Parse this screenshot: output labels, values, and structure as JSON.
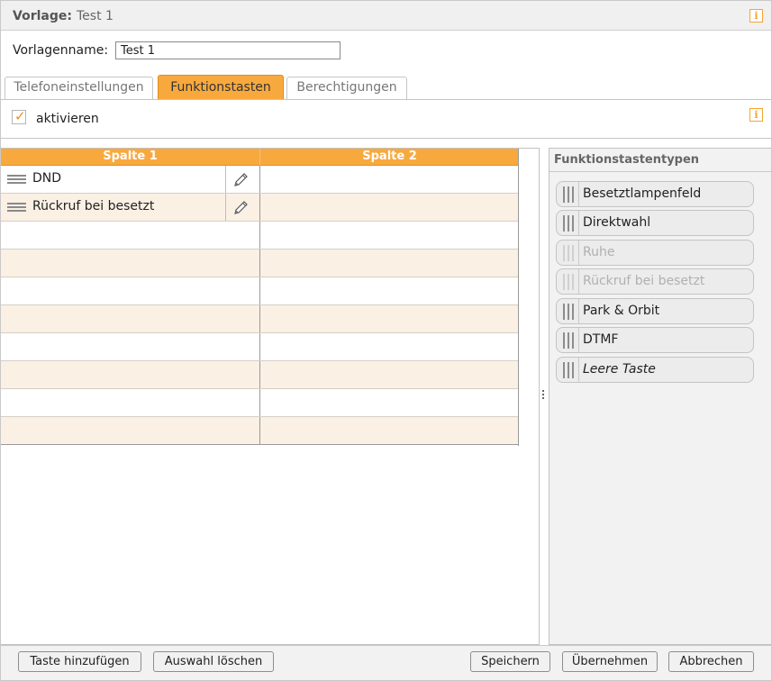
{
  "header": {
    "label": "Vorlage:",
    "value": "Test 1"
  },
  "name_field": {
    "label": "Vorlagenname:",
    "value": "Test 1"
  },
  "tabs": [
    {
      "label": "Telefoneinstellungen",
      "active": false
    },
    {
      "label": "Funktionstasten",
      "active": true
    },
    {
      "label": "Berechtigungen",
      "active": false
    }
  ],
  "activate": {
    "label": "aktivieren",
    "checked": true
  },
  "grid": {
    "columns": [
      "Spalte 1",
      "Spalte 2"
    ],
    "rows": [
      {
        "col1": "DND",
        "col2": ""
      },
      {
        "col1": "Rückruf bei besetzt",
        "col2": ""
      },
      {
        "col1": "",
        "col2": ""
      },
      {
        "col1": "",
        "col2": ""
      },
      {
        "col1": "",
        "col2": ""
      },
      {
        "col1": "",
        "col2": ""
      },
      {
        "col1": "",
        "col2": ""
      },
      {
        "col1": "",
        "col2": ""
      },
      {
        "col1": "",
        "col2": ""
      },
      {
        "col1": "",
        "col2": ""
      }
    ]
  },
  "types_panel": {
    "title": "Funktionstastentypen",
    "items": [
      {
        "label": "Besetztlampenfeld",
        "disabled": false,
        "italic": false
      },
      {
        "label": "Direktwahl",
        "disabled": false,
        "italic": false
      },
      {
        "label": "Ruhe",
        "disabled": true,
        "italic": false
      },
      {
        "label": "Rückruf bei besetzt",
        "disabled": true,
        "italic": false
      },
      {
        "label": "Park & Orbit",
        "disabled": false,
        "italic": false
      },
      {
        "label": "DTMF",
        "disabled": false,
        "italic": false
      },
      {
        "label": "Leere Taste",
        "disabled": false,
        "italic": true
      }
    ]
  },
  "footer": {
    "add_key": "Taste hinzufügen",
    "clear_selection": "Auswahl löschen",
    "save": "Speichern",
    "apply": "Übernehmen",
    "cancel": "Abbrechen"
  },
  "colors": {
    "accent": "#f8a93e",
    "alt_row": "#faf0e4",
    "check": "#f08c15"
  },
  "icons": {
    "info": "info-icon",
    "edit": "pencil-icon",
    "drag": "drag-handle-icon"
  }
}
